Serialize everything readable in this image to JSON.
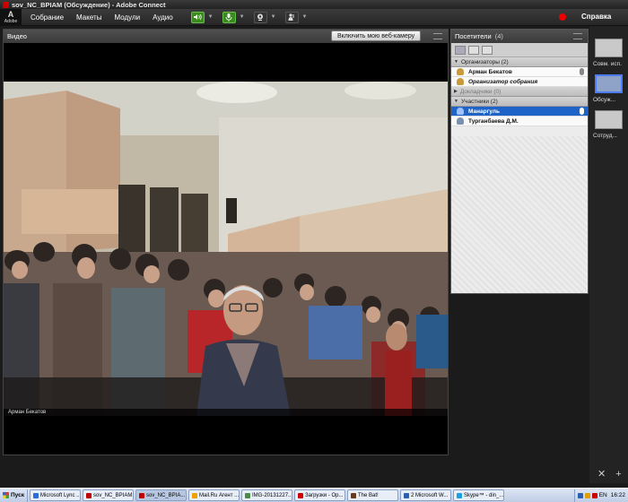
{
  "window": {
    "title": "sov_NC_BPIAM (Обсуждение) - Adobe Connect"
  },
  "brand": {
    "logo_text": "Adobe"
  },
  "menu": [
    "Собрание",
    "Макеты",
    "Модули",
    "Аудио"
  ],
  "header": {
    "help": "Справка"
  },
  "video_pod": {
    "title": "Видео",
    "webcam_button": "Включить мою веб-камеру",
    "speaker_name": "Арман Бекатов"
  },
  "attendees_pod": {
    "title": "Посетители",
    "count": "(4)",
    "groups": [
      {
        "label": "Организаторы (2)",
        "expanded": true,
        "people": [
          {
            "name": "Арман Бекатов",
            "italic": false,
            "selected": false,
            "mic": true
          },
          {
            "name": "Организатор собрания",
            "italic": true,
            "selected": false,
            "mic": false
          }
        ]
      },
      {
        "label": "Докладчики (0)",
        "expanded": false,
        "people": []
      },
      {
        "label": "Участники (2)",
        "expanded": true,
        "people": [
          {
            "name": "Манаргуль",
            "italic": false,
            "selected": true,
            "mic": true
          },
          {
            "name": "Турганбаева Д.М.",
            "italic": false,
            "selected": false,
            "mic": false
          }
        ]
      }
    ]
  },
  "layouts": [
    "Совм. исп.",
    "Обсуж...",
    "Сотруд..."
  ],
  "taskbar": {
    "start": "Пуск",
    "tasks": [
      {
        "label": "Microsoft Lync ...",
        "color": "#2b6fd6",
        "active": false
      },
      {
        "label": "sov_NC_BPIAM...",
        "color": "#c00000",
        "active": false
      },
      {
        "label": "sov_NC_BPIA...",
        "color": "#c00000",
        "active": true
      },
      {
        "label": "Mail.Ru Агент ...",
        "color": "#f0a000",
        "active": false
      },
      {
        "label": "IMG-20131227...",
        "color": "#4a8a4a",
        "active": false
      },
      {
        "label": "Загрузки - Op...",
        "color": "#d00000",
        "active": false
      },
      {
        "label": "The Bat!",
        "color": "#6a3a1a",
        "active": false
      },
      {
        "label": "2 Microsoft W...",
        "color": "#2b5fb0",
        "active": false
      },
      {
        "label": "Skype™ - din_...",
        "color": "#1aa0e0",
        "active": false
      }
    ],
    "clock": "16:22",
    "lang": "EN"
  },
  "colors": {
    "accent": "#1e64c8",
    "record": "#e00000",
    "mic_active": "#3a8a20"
  }
}
